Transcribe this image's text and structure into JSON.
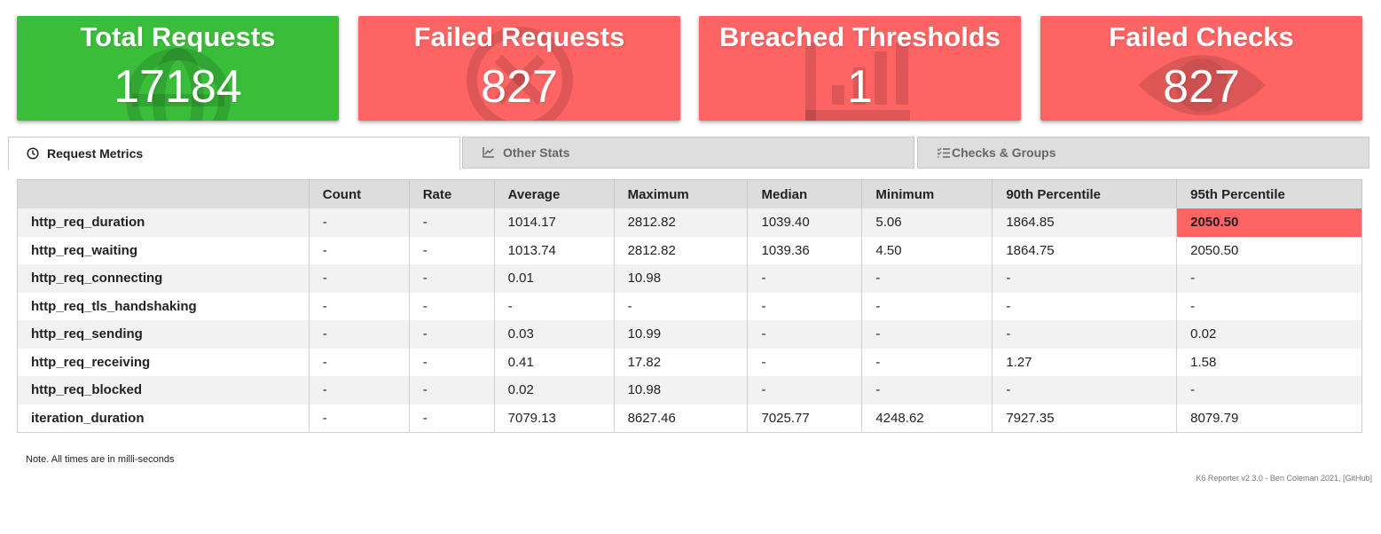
{
  "cards": [
    {
      "title": "Total Requests",
      "value": "17184",
      "color": "#3abe3a",
      "icon": "globe-icon"
    },
    {
      "title": "Failed Requests",
      "value": "827",
      "color": "#ff6464",
      "icon": "x-circle-icon"
    },
    {
      "title": "Breached Thresholds",
      "value": "1",
      "color": "#ff6464",
      "icon": "bar-chart-icon"
    },
    {
      "title": "Failed Checks",
      "value": "827",
      "color": "#ff6464",
      "icon": "eye-icon"
    }
  ],
  "tabs": [
    {
      "label": "Request Metrics",
      "icon": "clock-icon",
      "active": true
    },
    {
      "label": "Other Stats",
      "icon": "line-chart-icon",
      "active": false
    },
    {
      "label": "Checks & Groups",
      "icon": "checklist-icon",
      "active": false
    }
  ],
  "table": {
    "headers": [
      "",
      "Count",
      "Rate",
      "Average",
      "Maximum",
      "Median",
      "Minimum",
      "90th Percentile",
      "95th Percentile"
    ],
    "rows": [
      [
        "http_req_duration",
        "-",
        "-",
        "1014.17",
        "2812.82",
        "1039.40",
        "5.06",
        "1864.85",
        "2050.50"
      ],
      [
        "http_req_waiting",
        "-",
        "-",
        "1013.74",
        "2812.82",
        "1039.36",
        "4.50",
        "1864.75",
        "2050.50"
      ],
      [
        "http_req_connecting",
        "-",
        "-",
        "0.01",
        "10.98",
        "-",
        "-",
        "-",
        "-"
      ],
      [
        "http_req_tls_handshaking",
        "-",
        "-",
        "-",
        "-",
        "-",
        "-",
        "-",
        "-"
      ],
      [
        "http_req_sending",
        "-",
        "-",
        "0.03",
        "10.99",
        "-",
        "-",
        "-",
        "0.02"
      ],
      [
        "http_req_receiving",
        "-",
        "-",
        "0.41",
        "17.82",
        "-",
        "-",
        "1.27",
        "1.58"
      ],
      [
        "http_req_blocked",
        "-",
        "-",
        "0.02",
        "10.98",
        "-",
        "-",
        "-",
        "-"
      ],
      [
        "iteration_duration",
        "-",
        "-",
        "7079.13",
        "8627.46",
        "7025.77",
        "4248.62",
        "7927.35",
        "8079.79"
      ]
    ],
    "breach_color": "#ff6464"
  },
  "note": "Note. All times are in milli-seconds",
  "footer": "K6 Reporter v2.3.0 - Ben Coleman 2021, [GitHub]"
}
